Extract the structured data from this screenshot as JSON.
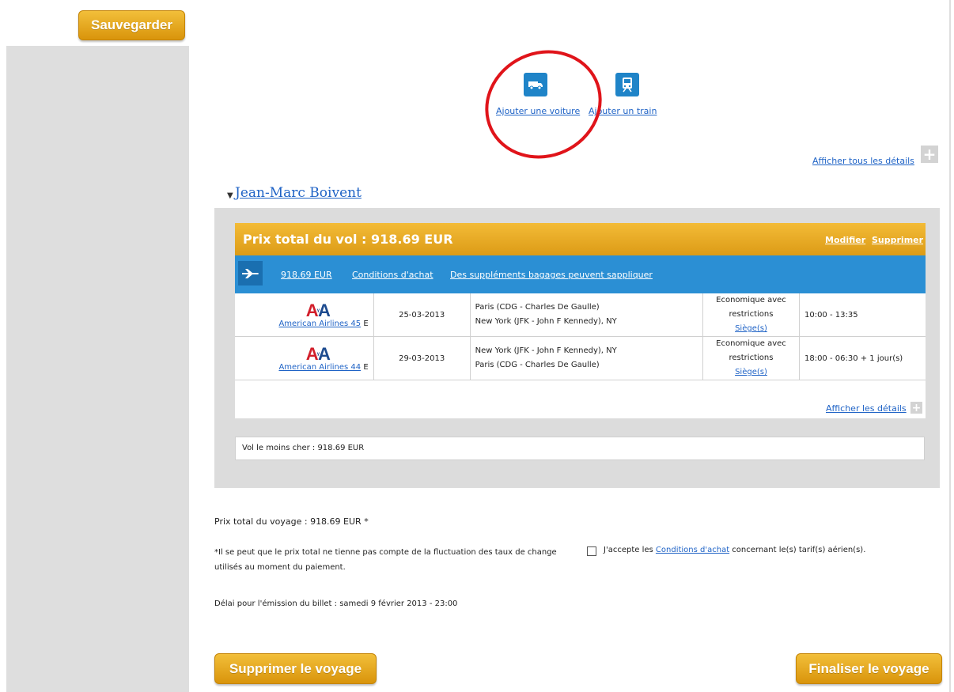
{
  "save_button": "Sauvegarder",
  "add_car": "Ajouter une voiture",
  "add_train": "Ajouter un train",
  "show_all_details": "Afficher tous les détails",
  "traveler_name": "Jean-Marc Boivent",
  "flight": {
    "price_title": "Prix total du vol : 918.69 EUR",
    "modify": "Modifier",
    "delete": "Supprimer",
    "fare": "918.69 EUR",
    "conditions": "Conditions d'achat",
    "baggage": "Des suppléments bagages peuvent sappliquer",
    "segments": [
      {
        "airline": "American Airlines 45",
        "airline_suffix": "E",
        "date": "25-03-2013",
        "from": "Paris (CDG - Charles De Gaulle)",
        "to": "New York (JFK - John F Kennedy), NY",
        "class": "Economique avec restrictions",
        "seat": "Siège(s)",
        "time": "10:00 - 13:35"
      },
      {
        "airline": "American Airlines 44",
        "airline_suffix": "E",
        "date": "29-03-2013",
        "from": "New York (JFK - John F Kennedy), NY",
        "to": "Paris (CDG - Charles De Gaulle)",
        "class": "Economique avec restrictions",
        "seat": "Siège(s)",
        "time": "18:00 - 06:30 + 1 jour(s)"
      }
    ],
    "show_details": "Afficher les détails",
    "cheapest": "Vol le moins cher : 918.69 EUR"
  },
  "total_trip": "Prix total du voyage : 918.69 EUR *",
  "note": "*Il se peut que le prix total ne tienne pas compte de la fluctuation des taux de change utilisés au moment du paiement.",
  "accept_prefix": "J'accepte les ",
  "accept_link": "Conditions d'achat",
  "accept_suffix": " concernant le(s) tarif(s) aérien(s).",
  "deadline": "Délai pour l'émission du billet : samedi 9 février 2013 - 23:00",
  "delete_trip_button": "Supprimer le voyage",
  "finalize_button": "Finaliser le voyage",
  "colors": {
    "accent_orange": "#e3a51f",
    "accent_blue": "#2b8fd4",
    "link_blue": "#1f63c6",
    "annotation_red": "#e0141a"
  }
}
